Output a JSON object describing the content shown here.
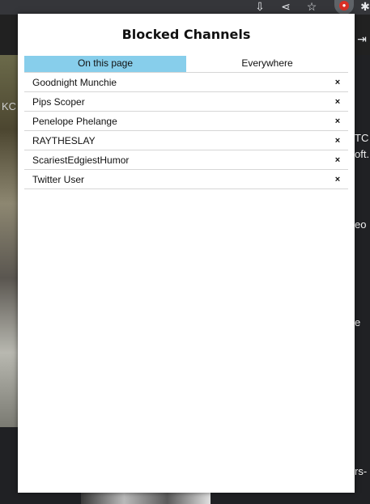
{
  "browser": {
    "icons": [
      "install-icon",
      "share-icon",
      "star-icon",
      "extension-icon",
      "puzzle-icon"
    ]
  },
  "popup": {
    "title": "Blocked Channels",
    "tabs": [
      {
        "label": "On this page",
        "active": true
      },
      {
        "label": "Everywhere",
        "active": false
      }
    ],
    "remove_label": "×",
    "channels": [
      {
        "name": "Goodnight Munchie"
      },
      {
        "name": "Pips Scoper"
      },
      {
        "name": "Penelope Phelange"
      },
      {
        "name": "RAYTHESLAY"
      },
      {
        "name": "ScariestEdgiestHumor"
      },
      {
        "name": "Twitter User"
      }
    ]
  },
  "background": {
    "fragments": [
      "TC",
      "oft..",
      "eo",
      "e",
      "rs-",
      "KC"
    ]
  },
  "colors": {
    "active_tab": "#87ceeb",
    "popup_bg": "#ffffff",
    "page_bg": "#202124"
  }
}
